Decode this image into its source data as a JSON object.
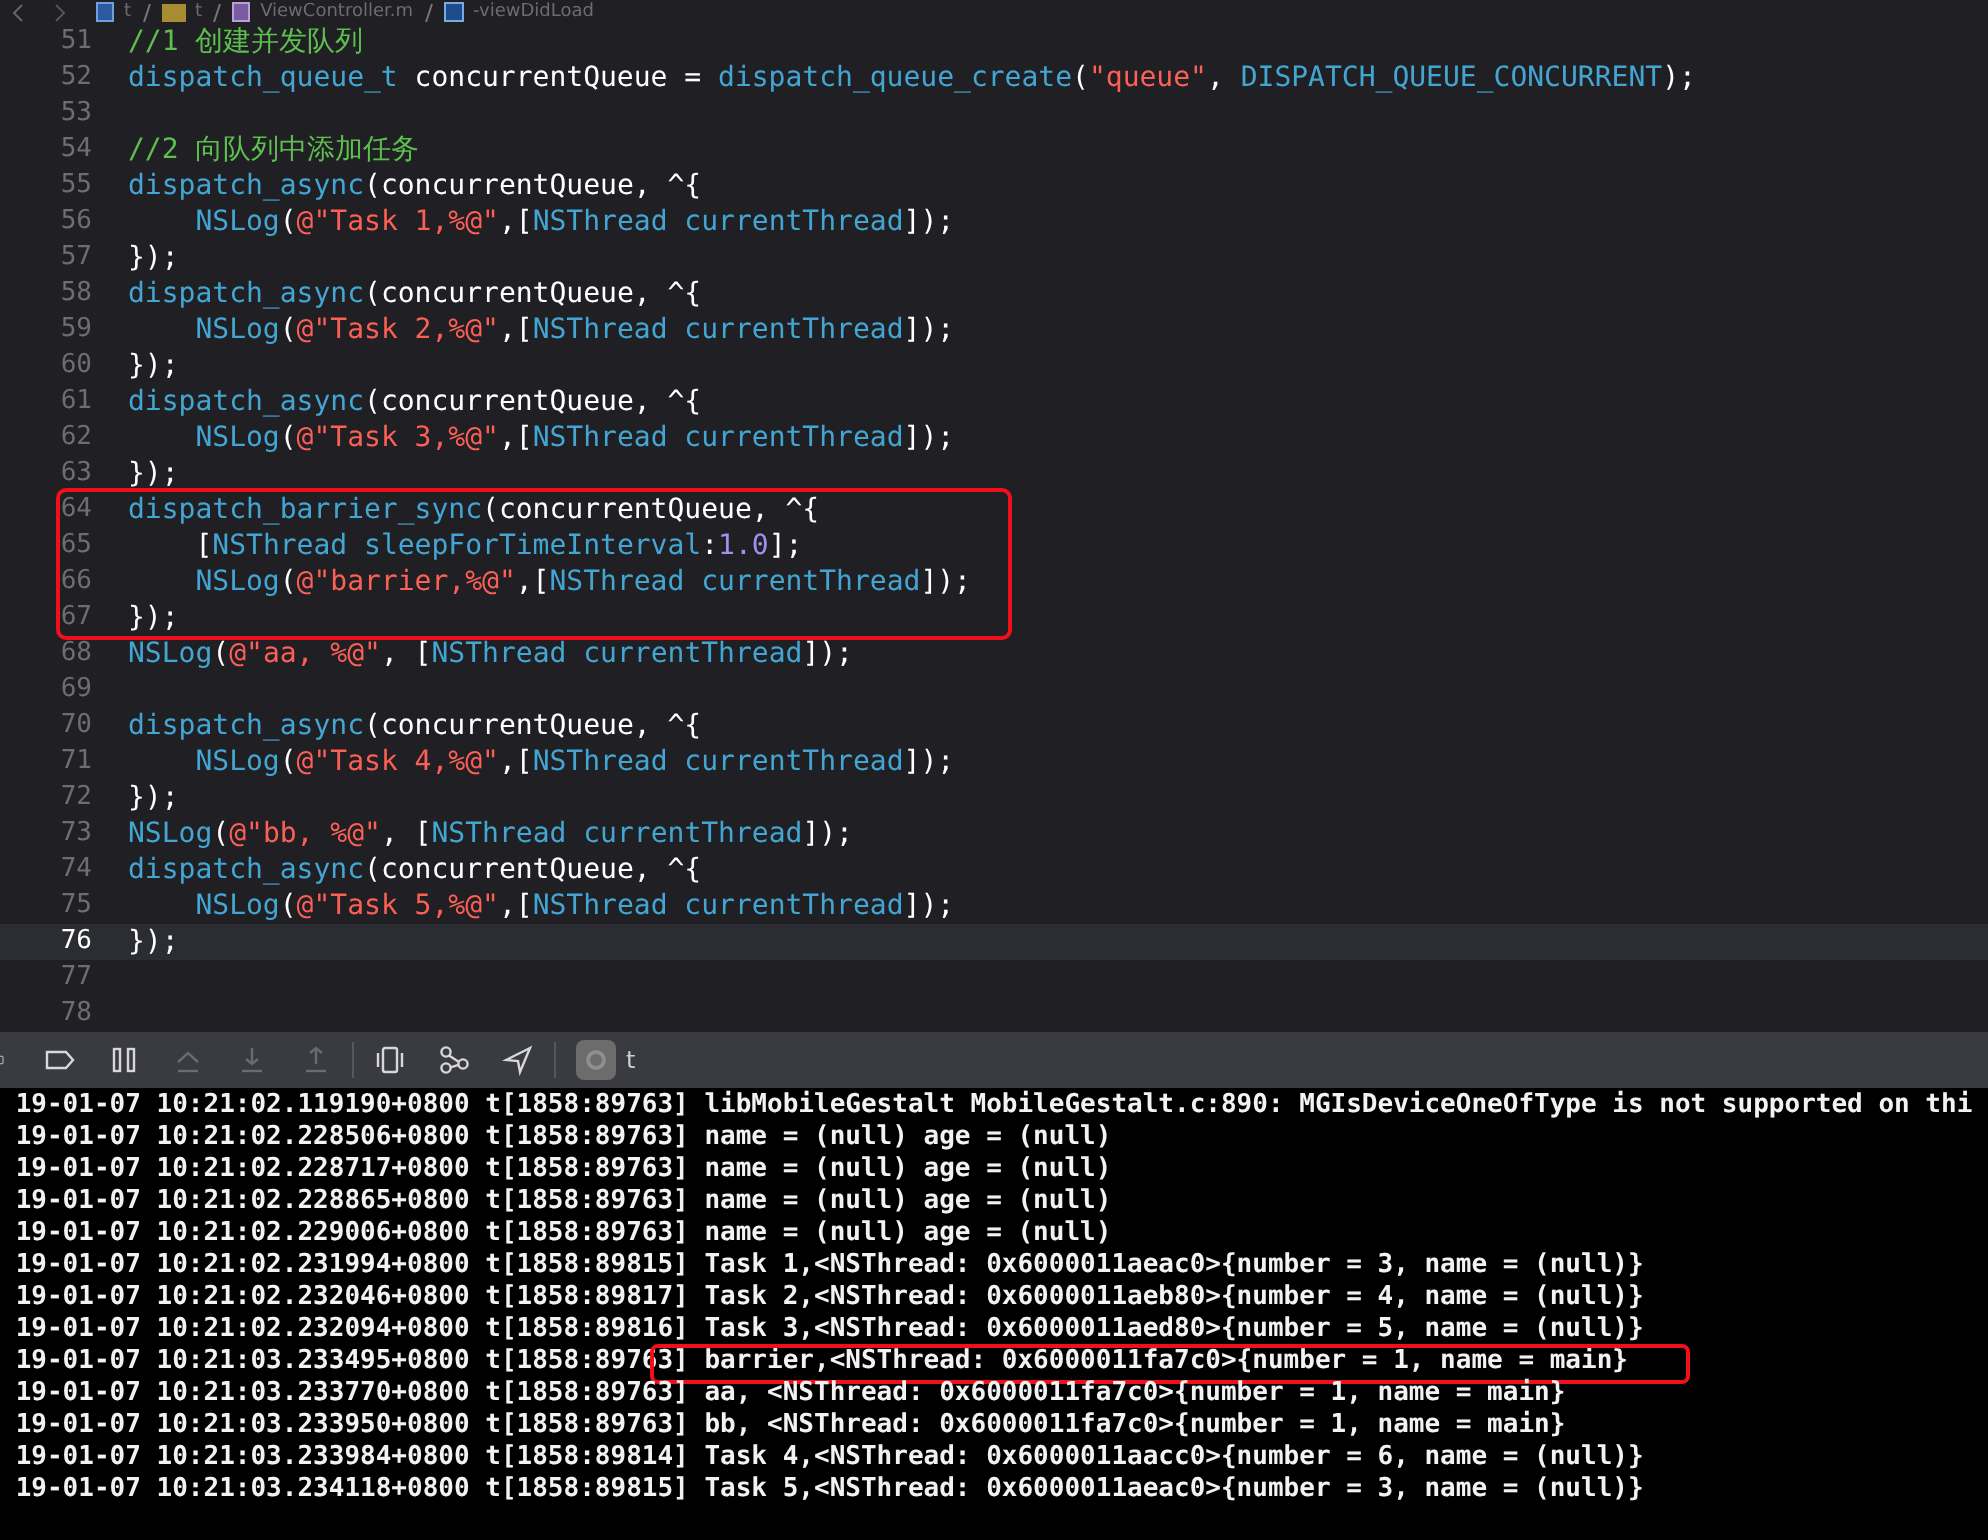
{
  "breadcrumb": [
    {
      "kind": "project",
      "text": "t"
    },
    {
      "kind": "folder",
      "text": "t"
    },
    {
      "kind": "file",
      "text": "ViewController.m"
    },
    {
      "kind": "method",
      "text": "-viewDidLoad"
    }
  ],
  "code_lines": [
    {
      "number": "51",
      "current": false,
      "boxed": false,
      "tokens": [
        {
          "kind": "comment",
          "text": "//1 创建并发队列"
        }
      ]
    },
    {
      "number": "52",
      "current": false,
      "boxed": false,
      "tokens": [
        {
          "kind": "fn",
          "text": "dispatch_queue_t"
        },
        {
          "kind": "plain",
          "text": " concurrentQueue = "
        },
        {
          "kind": "fn",
          "text": "dispatch_queue_create"
        },
        {
          "kind": "plain",
          "text": "("
        },
        {
          "kind": "string",
          "text": "\"queue\""
        },
        {
          "kind": "plain",
          "text": ", "
        },
        {
          "kind": "fn",
          "text": "DISPATCH_QUEUE_CONCURRENT"
        },
        {
          "kind": "plain",
          "text": ");"
        }
      ]
    },
    {
      "number": "53",
      "current": false,
      "boxed": false
    },
    {
      "number": "54",
      "current": false,
      "boxed": false,
      "tokens": [
        {
          "kind": "comment",
          "text": "//2 向队列中添加任务"
        }
      ]
    },
    {
      "number": "55",
      "current": false,
      "boxed": false,
      "tokens": [
        {
          "kind": "fn",
          "text": "dispatch_async"
        },
        {
          "kind": "plain",
          "text": "(concurrentQueue, ^{"
        }
      ]
    },
    {
      "number": "56",
      "current": false,
      "boxed": false,
      "tokens": [
        {
          "kind": "fn",
          "text": "    NSLog"
        },
        {
          "kind": "plain",
          "text": "("
        },
        {
          "kind": "string",
          "text": "@\"Task 1,%@\""
        },
        {
          "kind": "plain",
          "text": ",["
        },
        {
          "kind": "fn",
          "text": "NSThread"
        },
        {
          "kind": "fn",
          "text": " currentThread"
        },
        {
          "kind": "plain",
          "text": "]);"
        }
      ]
    },
    {
      "number": "57",
      "current": false,
      "boxed": false,
      "tokens": [
        {
          "kind": "plain",
          "text": "});"
        }
      ]
    },
    {
      "number": "58",
      "current": false,
      "boxed": false,
      "tokens": [
        {
          "kind": "fn",
          "text": "dispatch_async"
        },
        {
          "kind": "plain",
          "text": "(concurrentQueue, ^{"
        }
      ]
    },
    {
      "number": "59",
      "current": false,
      "boxed": false,
      "tokens": [
        {
          "kind": "fn",
          "text": "    NSLog"
        },
        {
          "kind": "plain",
          "text": "("
        },
        {
          "kind": "string",
          "text": "@\"Task 2,%@\""
        },
        {
          "kind": "plain",
          "text": ",["
        },
        {
          "kind": "fn",
          "text": "NSThread"
        },
        {
          "kind": "fn",
          "text": " currentThread"
        },
        {
          "kind": "plain",
          "text": "]);"
        }
      ]
    },
    {
      "number": "60",
      "current": false,
      "boxed": false,
      "tokens": [
        {
          "kind": "plain",
          "text": "});"
        }
      ]
    },
    {
      "number": "61",
      "current": false,
      "boxed": false,
      "tokens": [
        {
          "kind": "fn",
          "text": "dispatch_async"
        },
        {
          "kind": "plain",
          "text": "(concurrentQueue, ^{"
        }
      ]
    },
    {
      "number": "62",
      "current": false,
      "boxed": false,
      "tokens": [
        {
          "kind": "fn",
          "text": "    NSLog"
        },
        {
          "kind": "plain",
          "text": "("
        },
        {
          "kind": "string",
          "text": "@\"Task 3,%@\""
        },
        {
          "kind": "plain",
          "text": ",["
        },
        {
          "kind": "fn",
          "text": "NSThread"
        },
        {
          "kind": "fn",
          "text": " currentThread"
        },
        {
          "kind": "plain",
          "text": "]);"
        }
      ]
    },
    {
      "number": "63",
      "current": false,
      "boxed": false,
      "tokens": [
        {
          "kind": "plain",
          "text": "});"
        }
      ]
    },
    {
      "number": "64",
      "current": false,
      "boxed": true,
      "tokens": [
        {
          "kind": "fn",
          "text": "dispatch_barrier_sync"
        },
        {
          "kind": "plain",
          "text": "(concurrentQueue, ^{"
        }
      ]
    },
    {
      "number": "65",
      "current": false,
      "boxed": true,
      "tokens": [
        {
          "kind": "plain",
          "text": "    ["
        },
        {
          "kind": "fn",
          "text": "NSThread"
        },
        {
          "kind": "fn",
          "text": " sleepForTimeInterval"
        },
        {
          "kind": "plain",
          "text": ":"
        },
        {
          "kind": "number",
          "text": "1.0"
        },
        {
          "kind": "plain",
          "text": "];"
        }
      ]
    },
    {
      "number": "66",
      "current": false,
      "boxed": true,
      "tokens": [
        {
          "kind": "fn",
          "text": "    NSLog"
        },
        {
          "kind": "plain",
          "text": "("
        },
        {
          "kind": "string",
          "text": "@\"barrier,%@\""
        },
        {
          "kind": "plain",
          "text": ",["
        },
        {
          "kind": "fn",
          "text": "NSThread"
        },
        {
          "kind": "fn",
          "text": " currentThread"
        },
        {
          "kind": "plain",
          "text": "]);"
        }
      ]
    },
    {
      "number": "67",
      "current": false,
      "boxed": true,
      "tokens": [
        {
          "kind": "plain",
          "text": "});"
        }
      ]
    },
    {
      "number": "68",
      "current": false,
      "boxed": false,
      "tokens": [
        {
          "kind": "fn",
          "text": "NSLog"
        },
        {
          "kind": "plain",
          "text": "("
        },
        {
          "kind": "string",
          "text": "@\"aa, %@\""
        },
        {
          "kind": "plain",
          "text": ", ["
        },
        {
          "kind": "fn",
          "text": "NSThread"
        },
        {
          "kind": "fn",
          "text": " currentThread"
        },
        {
          "kind": "plain",
          "text": "]);"
        }
      ]
    },
    {
      "number": "69",
      "current": false,
      "boxed": false
    },
    {
      "number": "70",
      "current": false,
      "boxed": false,
      "tokens": [
        {
          "kind": "fn",
          "text": "dispatch_async"
        },
        {
          "kind": "plain",
          "text": "(concurrentQueue, ^{"
        }
      ]
    },
    {
      "number": "71",
      "current": false,
      "boxed": false,
      "tokens": [
        {
          "kind": "fn",
          "text": "    NSLog"
        },
        {
          "kind": "plain",
          "text": "("
        },
        {
          "kind": "string",
          "text": "@\"Task 4,%@\""
        },
        {
          "kind": "plain",
          "text": ",["
        },
        {
          "kind": "fn",
          "text": "NSThread"
        },
        {
          "kind": "fn",
          "text": " currentThread"
        },
        {
          "kind": "plain",
          "text": "]);"
        }
      ]
    },
    {
      "number": "72",
      "current": false,
      "boxed": false,
      "tokens": [
        {
          "kind": "plain",
          "text": "});"
        }
      ]
    },
    {
      "number": "73",
      "current": false,
      "boxed": false,
      "tokens": [
        {
          "kind": "fn",
          "text": "NSLog"
        },
        {
          "kind": "plain",
          "text": "("
        },
        {
          "kind": "string",
          "text": "@\"bb, %@\""
        },
        {
          "kind": "plain",
          "text": ", ["
        },
        {
          "kind": "fn",
          "text": "NSThread"
        },
        {
          "kind": "fn",
          "text": " currentThread"
        },
        {
          "kind": "plain",
          "text": "]);"
        }
      ]
    },
    {
      "number": "74",
      "current": false,
      "boxed": false,
      "tokens": [
        {
          "kind": "fn",
          "text": "dispatch_async"
        },
        {
          "kind": "plain",
          "text": "(concurrentQueue, ^{"
        }
      ]
    },
    {
      "number": "75",
      "current": false,
      "boxed": false,
      "tokens": [
        {
          "kind": "fn",
          "text": "    NSLog"
        },
        {
          "kind": "plain",
          "text": "("
        },
        {
          "kind": "string",
          "text": "@\"Task 5,%@\""
        },
        {
          "kind": "plain",
          "text": ",["
        },
        {
          "kind": "fn",
          "text": "NSThread"
        },
        {
          "kind": "fn",
          "text": " currentThread"
        },
        {
          "kind": "plain",
          "text": "]);"
        }
      ]
    },
    {
      "number": "76",
      "current": true,
      "boxed": false,
      "tokens": [
        {
          "kind": "plain",
          "text": "});"
        }
      ]
    },
    {
      "number": "77",
      "current": false,
      "boxed": false
    },
    {
      "number": "78",
      "current": false,
      "boxed": false
    }
  ],
  "debug_bar": {
    "buttons": [
      {
        "kind": "console",
        "disabled": false
      },
      {
        "kind": "breakpoints",
        "disabled": false
      },
      {
        "kind": "pause",
        "disabled": false
      },
      {
        "kind": "step-over",
        "disabled": true
      },
      {
        "kind": "step-into",
        "disabled": true
      },
      {
        "kind": "step-out",
        "disabled": true
      },
      {
        "kind": "separator"
      },
      {
        "kind": "view-debugger",
        "disabled": false
      },
      {
        "kind": "memory-graph",
        "disabled": false
      },
      {
        "kind": "location",
        "disabled": false
      },
      {
        "kind": "separator"
      }
    ],
    "target": "t"
  },
  "console_lines": [
    {
      "text": "19-01-07 10:21:02.119190+0800 t[1858:89763] libMobileGestalt MobileGestalt.c:890: MGIsDeviceOneOfType is not supported on thi",
      "boxed": false
    },
    {
      "text": "19-01-07 10:21:02.228506+0800 t[1858:89763] name = (null) age = (null)",
      "boxed": false
    },
    {
      "text": "19-01-07 10:21:02.228717+0800 t[1858:89763] name = (null) age = (null)",
      "boxed": false
    },
    {
      "text": "19-01-07 10:21:02.228865+0800 t[1858:89763] name = (null) age = (null)",
      "boxed": false
    },
    {
      "text": "19-01-07 10:21:02.229006+0800 t[1858:89763] name = (null) age = (null)",
      "boxed": false
    },
    {
      "text": "19-01-07 10:21:02.231994+0800 t[1858:89815] Task 1,<NSThread: 0x6000011aeac0>{number = 3, name = (null)}",
      "boxed": false
    },
    {
      "text": "19-01-07 10:21:02.232046+0800 t[1858:89817] Task 2,<NSThread: 0x6000011aeb80>{number = 4, name = (null)}",
      "boxed": false
    },
    {
      "text": "19-01-07 10:21:02.232094+0800 t[1858:89816] Task 3,<NSThread: 0x6000011aed80>{number = 5, name = (null)}",
      "boxed": false
    },
    {
      "text": "19-01-07 10:21:03.233495+0800 t[1858:89763] barrier,<NSThread: 0x6000011fa7c0>{number = 1, name = main}",
      "boxed": true
    },
    {
      "text": "19-01-07 10:21:03.233770+0800 t[1858:89763] aa, <NSThread: 0x6000011fa7c0>{number = 1, name = main}",
      "boxed": false
    },
    {
      "text": "19-01-07 10:21:03.233950+0800 t[1858:89763] bb, <NSThread: 0x6000011fa7c0>{number = 1, name = main}",
      "boxed": false
    },
    {
      "text": "19-01-07 10:21:03.233984+0800 t[1858:89814] Task 4,<NSThread: 0x6000011aacc0>{number = 6, name = (null)}",
      "boxed": false
    },
    {
      "text": "19-01-07 10:21:03.234118+0800 t[1858:89815] Task 5,<NSThread: 0x6000011aeac0>{number = 3, name = (null)}",
      "boxed": false
    }
  ]
}
